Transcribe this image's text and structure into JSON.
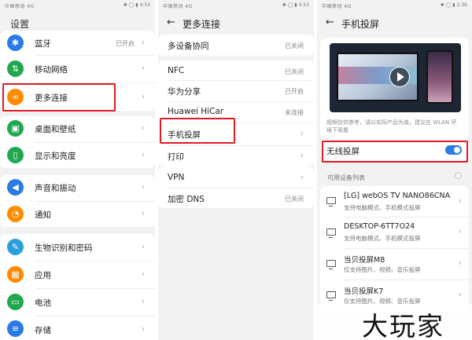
{
  "panel1": {
    "status_left": "中国移动 4G",
    "status_right": "✱ ◯ ▮ 4:53",
    "title": "设置",
    "items": [
      {
        "label": "蓝牙",
        "value": "已开启",
        "icon": "bluetooth-icon",
        "color": "#2a7be5",
        "glyph": "✱"
      },
      {
        "label": "移动网络",
        "value": "",
        "icon": "mobile-network-icon",
        "color": "#1fa84f",
        "glyph": "⇅"
      },
      {
        "label": "更多连接",
        "value": "",
        "icon": "more-connections-icon",
        "color": "#ff8a00",
        "glyph": "∞"
      },
      {
        "label": "桌面和壁纸",
        "value": "",
        "icon": "wallpaper-icon",
        "color": "#1fa84f",
        "glyph": "▣"
      },
      {
        "label": "显示和亮度",
        "value": "",
        "icon": "display-icon",
        "color": "#1fa84f",
        "glyph": "▯"
      },
      {
        "label": "声音和振动",
        "value": "",
        "icon": "sound-icon",
        "color": "#2a7be5",
        "glyph": "◀"
      },
      {
        "label": "通知",
        "value": "",
        "icon": "notification-icon",
        "color": "#ff8a00",
        "glyph": "◔"
      },
      {
        "label": "生物识别和密码",
        "value": "",
        "icon": "biometrics-icon",
        "color": "#2a9fd8",
        "glyph": "✎"
      },
      {
        "label": "应用",
        "value": "",
        "icon": "apps-icon",
        "color": "#ff8a00",
        "glyph": "▦"
      },
      {
        "label": "电池",
        "value": "",
        "icon": "battery-icon",
        "color": "#1fa84f",
        "glyph": "▭"
      },
      {
        "label": "存储",
        "value": "",
        "icon": "storage-icon",
        "color": "#2a7be5",
        "glyph": "≡"
      }
    ]
  },
  "panel2": {
    "status_left": "中国移动 4G",
    "status_right": "✱ ◯ ▮ 4:53",
    "back": "←",
    "title": "更多连接",
    "items": [
      {
        "label": "多设备协同",
        "value": "已关闭"
      },
      {
        "label": "NFC",
        "value": "已关闭"
      },
      {
        "label": "华为分享",
        "value": "已开启"
      },
      {
        "label": "Huawei HiCar",
        "value": "未连接"
      },
      {
        "label": "手机投屏",
        "value": ""
      },
      {
        "label": "打印",
        "value": ""
      },
      {
        "label": "VPN",
        "value": ""
      },
      {
        "label": "加密 DNS",
        "value": "已关闭"
      }
    ]
  },
  "panel3": {
    "status_left": "中国移动 4G",
    "status_right": "✱ ◯ ▮ 2:36",
    "back": "←",
    "title": "手机投屏",
    "caption": "视频仅供参考，请以实际产品为准，建议在 WLAN 环境下观看",
    "wireless_label": "无线投屏",
    "wireless_on": true,
    "list_header": "可用设备列表",
    "devices": [
      {
        "name": "[LG] webOS TV NANO86CNA",
        "desc": "支持电脑模式、手机模式投屏"
      },
      {
        "name": "DESKTOP-6TT7O24",
        "desc": "支持电脑模式、手机模式投屏"
      },
      {
        "name": "当贝投屏M8",
        "desc": "仅支持图片、视频、音乐投屏"
      },
      {
        "name": "当贝投屏K7",
        "desc": "仅支持图片、视频、音乐投屏"
      }
    ]
  },
  "watermark": {
    "text": "大玩家"
  },
  "colors": {
    "highlight": "#e01a22",
    "accent": "#2a7be5"
  }
}
